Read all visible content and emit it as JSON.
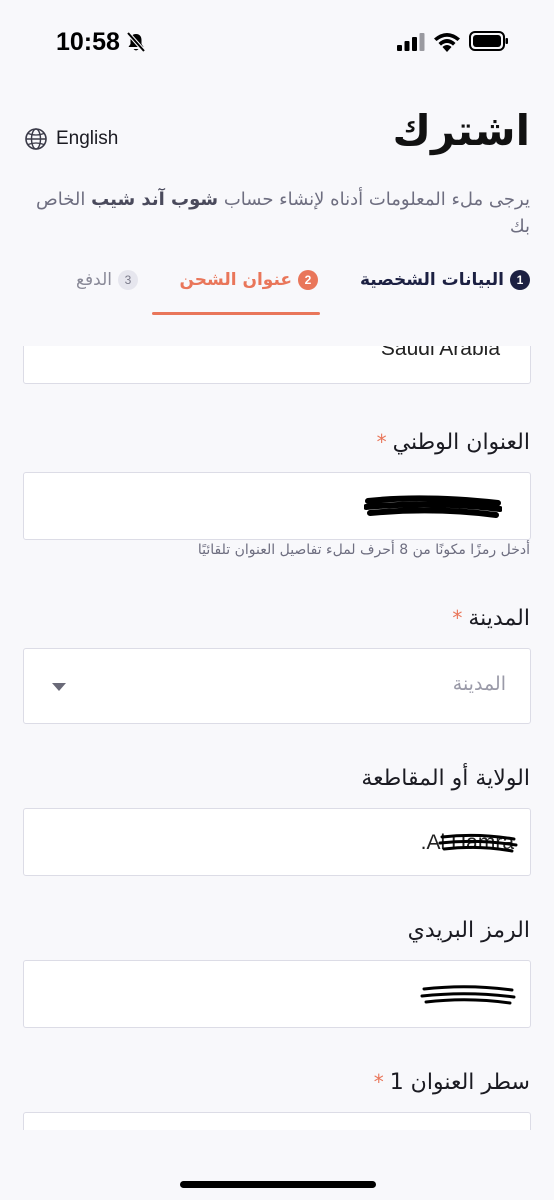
{
  "status": {
    "time": "10:58"
  },
  "header": {
    "language_label": "English",
    "title": "اشترك",
    "subtitle_part1": "يرجى ملء المعلومات أدناه لإنشاء حساب ",
    "subtitle_brand": "شوب آند شيب",
    "subtitle_part2": " الخاص بك"
  },
  "steps": [
    {
      "number": "1",
      "label": "البيانات الشخصية",
      "state": "completed"
    },
    {
      "number": "2",
      "label": "عنوان الشحن",
      "state": "active"
    },
    {
      "number": "3",
      "label": "الدفع",
      "state": "upcoming"
    }
  ],
  "form": {
    "country": {
      "value": "Saudi Arabia"
    },
    "national_address": {
      "label": "العنوان الوطني",
      "required_mark": "*",
      "hint": "أدخل رمزًا مكونًا من 8 أحرف لملء تفاصيل العنوان تلقائيًا"
    },
    "city": {
      "label": "المدينة",
      "required_mark": "*",
      "placeholder": "المدينة"
    },
    "state": {
      "label": "الولاية أو المقاطعة",
      "value": ".Al Hamra"
    },
    "postal_code": {
      "label": "الرمز البريدي"
    },
    "address_line1": {
      "label": "سطر العنوان 1",
      "required_mark": "*"
    }
  },
  "colors": {
    "accent": "#e9765a",
    "navy": "#1c2042",
    "text_muted": "#6e6e80"
  }
}
